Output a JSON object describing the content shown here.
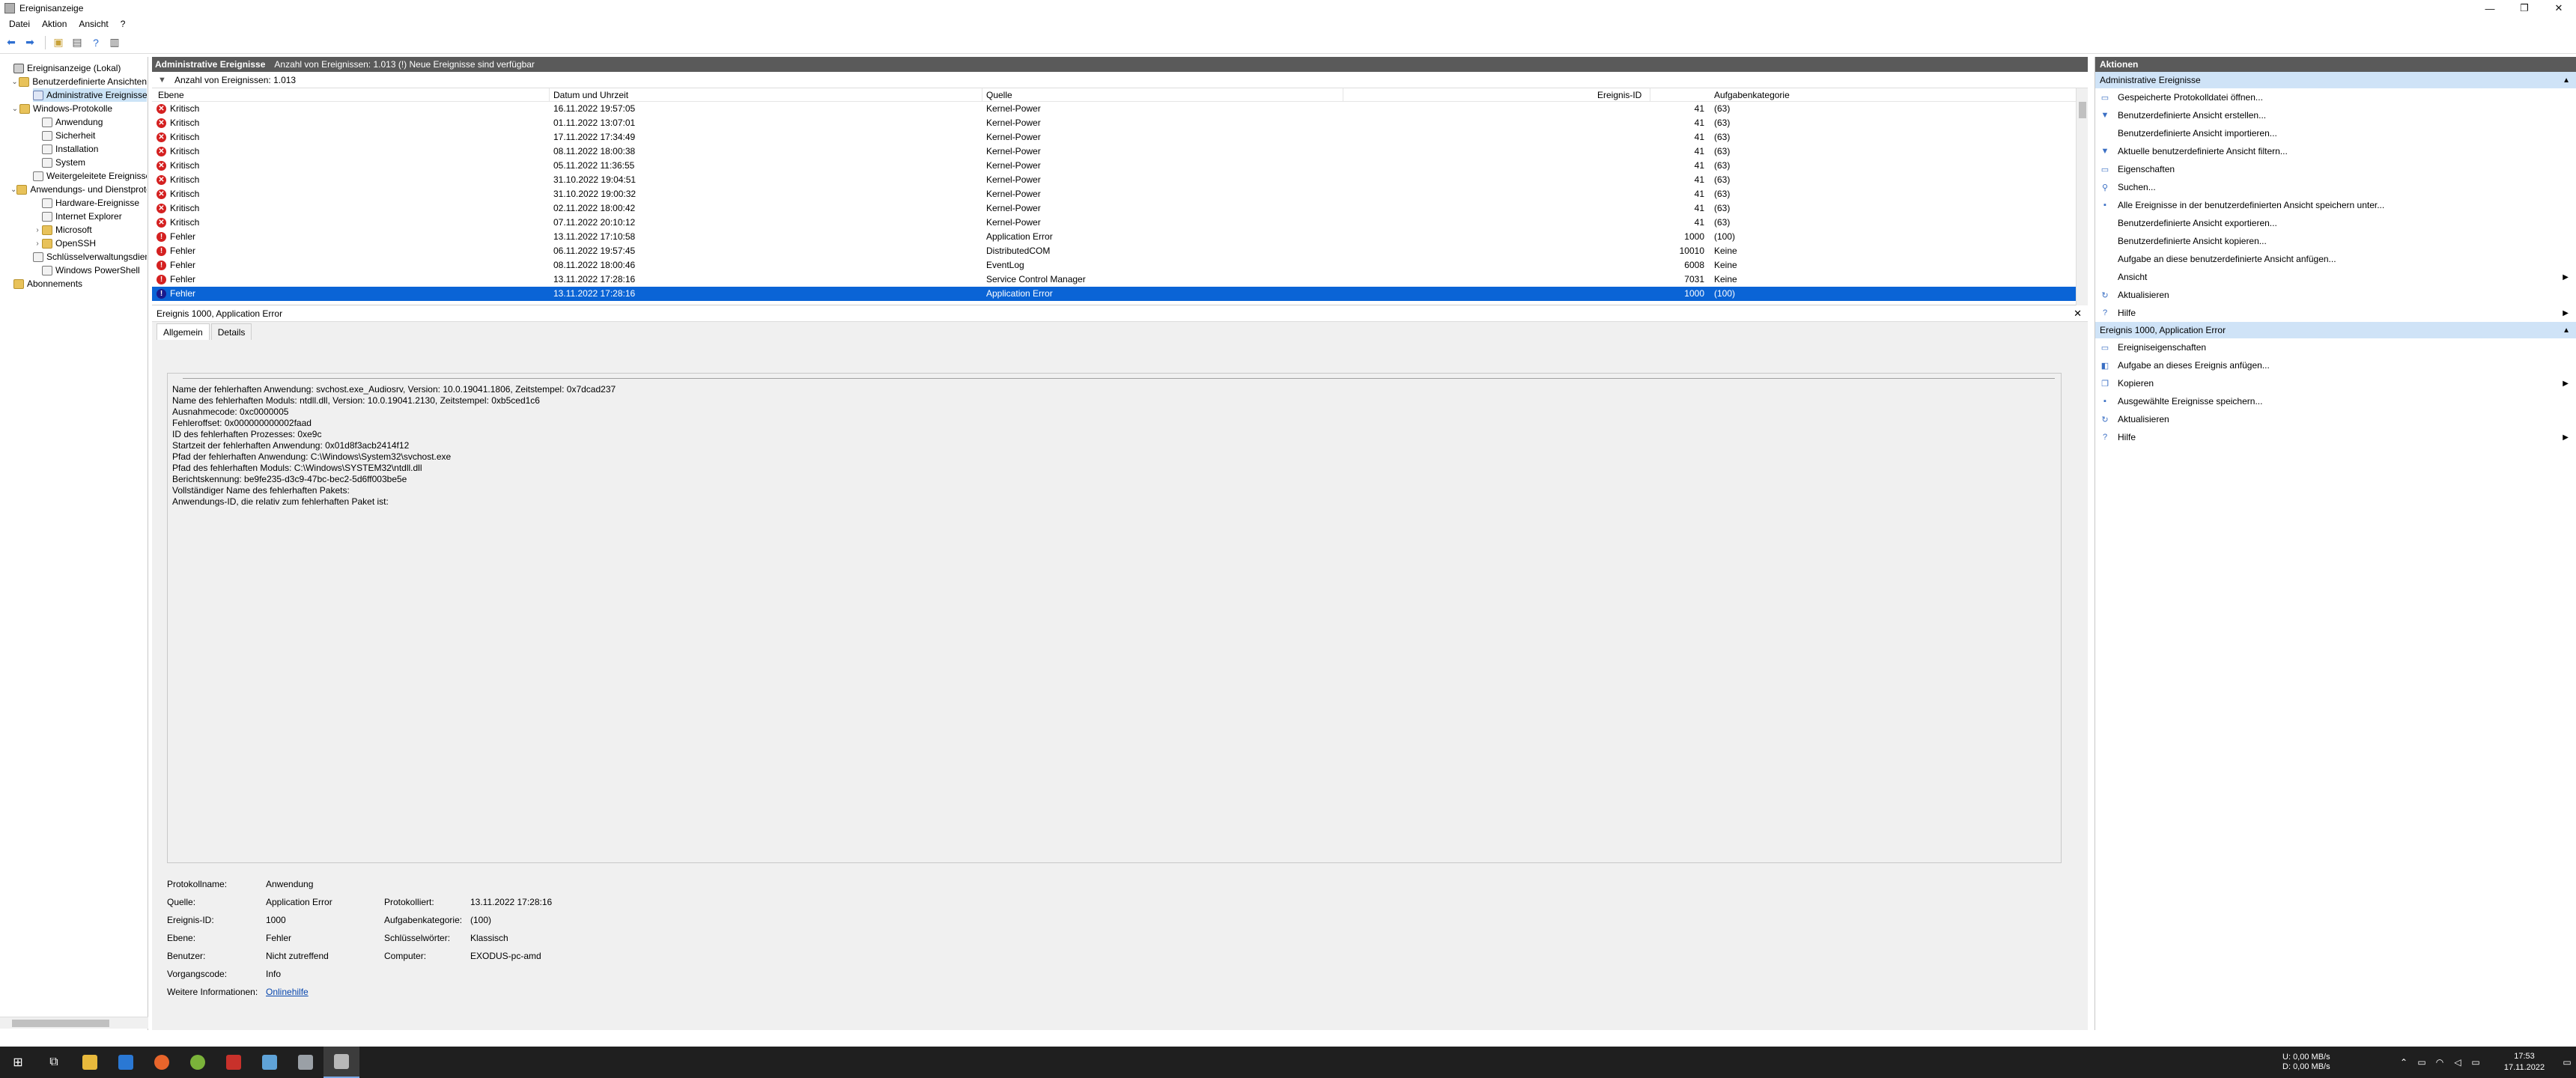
{
  "window": {
    "title": "Ereignisanzeige"
  },
  "menu": [
    "Datei",
    "Aktion",
    "Ansicht",
    "?"
  ],
  "tree": [
    {
      "label": "Ereignisanzeige (Lokal)",
      "level": 0,
      "icon": "root",
      "exp": ""
    },
    {
      "label": "Benutzerdefinierte Ansichten",
      "level": 1,
      "icon": "folder",
      "exp": "⌄"
    },
    {
      "label": "Administrative Ereignisse",
      "level": 2,
      "icon": "filter",
      "exp": "",
      "selected": true
    },
    {
      "label": "Windows-Protokolle",
      "level": 1,
      "icon": "folder",
      "exp": "⌄"
    },
    {
      "label": "Anwendung",
      "level": 2,
      "icon": "log",
      "exp": ""
    },
    {
      "label": "Sicherheit",
      "level": 2,
      "icon": "log",
      "exp": ""
    },
    {
      "label": "Installation",
      "level": 2,
      "icon": "log",
      "exp": ""
    },
    {
      "label": "System",
      "level": 2,
      "icon": "log",
      "exp": ""
    },
    {
      "label": "Weitergeleitete Ereignisse",
      "level": 2,
      "icon": "log",
      "exp": ""
    },
    {
      "label": "Anwendungs- und Dienstprotokolle",
      "level": 1,
      "icon": "folder",
      "exp": "⌄"
    },
    {
      "label": "Hardware-Ereignisse",
      "level": 2,
      "icon": "log",
      "exp": ""
    },
    {
      "label": "Internet Explorer",
      "level": 2,
      "icon": "log",
      "exp": ""
    },
    {
      "label": "Microsoft",
      "level": 2,
      "icon": "folder",
      "exp": "›"
    },
    {
      "label": "OpenSSH",
      "level": 2,
      "icon": "folder",
      "exp": "›"
    },
    {
      "label": "Schlüsselverwaltungsdienst",
      "level": 2,
      "icon": "log",
      "exp": ""
    },
    {
      "label": "Windows PowerShell",
      "level": 2,
      "icon": "log",
      "exp": ""
    },
    {
      "label": "Abonnements",
      "level": 0,
      "icon": "folder",
      "exp": ""
    }
  ],
  "middle": {
    "header_title": "Administrative Ereignisse",
    "header_info": "Anzahl von Ereignissen: 1.013 (!) Neue Ereignisse sind verfügbar",
    "filter_text": "Anzahl von Ereignissen: 1.013",
    "columns": {
      "level": "Ebene",
      "date": "Datum und Uhrzeit",
      "source": "Quelle",
      "id": "Ereignis-ID",
      "category": "Aufgabenkategorie"
    },
    "rows": [
      {
        "level": "Kritisch",
        "type": "crit",
        "date": "16.11.2022 19:57:05",
        "source": "Kernel-Power",
        "id": "41",
        "category": "(63)"
      },
      {
        "level": "Kritisch",
        "type": "crit",
        "date": "01.11.2022 13:07:01",
        "source": "Kernel-Power",
        "id": "41",
        "category": "(63)"
      },
      {
        "level": "Kritisch",
        "type": "crit",
        "date": "17.11.2022 17:34:49",
        "source": "Kernel-Power",
        "id": "41",
        "category": "(63)"
      },
      {
        "level": "Kritisch",
        "type": "crit",
        "date": "08.11.2022 18:00:38",
        "source": "Kernel-Power",
        "id": "41",
        "category": "(63)"
      },
      {
        "level": "Kritisch",
        "type": "crit",
        "date": "05.11.2022 11:36:55",
        "source": "Kernel-Power",
        "id": "41",
        "category": "(63)"
      },
      {
        "level": "Kritisch",
        "type": "crit",
        "date": "31.10.2022 19:04:51",
        "source": "Kernel-Power",
        "id": "41",
        "category": "(63)"
      },
      {
        "level": "Kritisch",
        "type": "crit",
        "date": "31.10.2022 19:00:32",
        "source": "Kernel-Power",
        "id": "41",
        "category": "(63)"
      },
      {
        "level": "Kritisch",
        "type": "crit",
        "date": "02.11.2022 18:00:42",
        "source": "Kernel-Power",
        "id": "41",
        "category": "(63)"
      },
      {
        "level": "Kritisch",
        "type": "crit",
        "date": "07.11.2022 20:10:12",
        "source": "Kernel-Power",
        "id": "41",
        "category": "(63)"
      },
      {
        "level": "Fehler",
        "type": "err",
        "date": "13.11.2022 17:10:58",
        "source": "Application Error",
        "id": "1000",
        "category": "(100)"
      },
      {
        "level": "Fehler",
        "type": "err",
        "date": "06.11.2022 19:57:45",
        "source": "DistributedCOM",
        "id": "10010",
        "category": "Keine"
      },
      {
        "level": "Fehler",
        "type": "err",
        "date": "08.11.2022 18:00:46",
        "source": "EventLog",
        "id": "6008",
        "category": "Keine"
      },
      {
        "level": "Fehler",
        "type": "err",
        "date": "13.11.2022 17:28:16",
        "source": "Service Control Manager",
        "id": "7031",
        "category": "Keine"
      },
      {
        "level": "Fehler",
        "type": "err",
        "date": "13.11.2022 17:28:16",
        "source": "Application Error",
        "id": "1000",
        "category": "(100)",
        "selected": true
      }
    ]
  },
  "detail": {
    "title": "Ereignis 1000, Application Error",
    "tabs": [
      "Allgemein",
      "Details"
    ],
    "description": [
      "Name der fehlerhaften Anwendung: svchost.exe_Audiosrv, Version: 10.0.19041.1806, Zeitstempel: 0x7dcad237",
      "Name des fehlerhaften Moduls: ntdll.dll, Version: 10.0.19041.2130, Zeitstempel: 0xb5ced1c6",
      "Ausnahmecode: 0xc0000005",
      "Fehleroffset: 0x000000000002faad",
      "ID des fehlerhaften Prozesses: 0xe9c",
      "Startzeit der fehlerhaften Anwendung: 0x01d8f3acb2414f12",
      "Pfad der fehlerhaften Anwendung: C:\\Windows\\System32\\svchost.exe",
      "Pfad des fehlerhaften Moduls: C:\\Windows\\SYSTEM32\\ntdll.dll",
      "Berichtskennung: be9fe235-d3c9-47bc-bec2-5d6ff003be5e",
      "Vollständiger Name des fehlerhaften Pakets:",
      "Anwendungs-ID, die relativ zum fehlerhaften Paket ist:"
    ],
    "props": {
      "log_label": "Protokollname:",
      "log_value": "Anwendung",
      "source_label": "Quelle:",
      "source_value": "Application Error",
      "logged_label": "Protokolliert:",
      "logged_value": "13.11.2022 17:28:16",
      "id_label": "Ereignis-ID:",
      "id_value": "1000",
      "task_label": "Aufgabenkategorie:",
      "task_value": "(100)",
      "level_label": "Ebene:",
      "level_value": "Fehler",
      "keywords_label": "Schlüsselwörter:",
      "keywords_value": "Klassisch",
      "user_label": "Benutzer:",
      "user_value": "Nicht zutreffend",
      "computer_label": "Computer:",
      "computer_value": "EXODUS-pc-amd",
      "opcode_label": "Vorgangscode:",
      "opcode_value": "Info",
      "more_label": "Weitere Informationen:",
      "more_link": "Onlinehilfe"
    }
  },
  "actions": {
    "title": "Aktionen",
    "section1": "Administrative Ereignisse",
    "items1": [
      {
        "label": "Gespeicherte Protokolldatei öffnen...",
        "icon": "open-log-icon",
        "glyph": "▭",
        "sub": false
      },
      {
        "label": "Benutzerdefinierte Ansicht erstellen...",
        "icon": "filter-icon",
        "glyph": "▼",
        "sub": false
      },
      {
        "label": "Benutzerdefinierte Ansicht importieren...",
        "icon": "",
        "glyph": "",
        "sub": false
      },
      {
        "label": "Aktuelle benutzerdefinierte Ansicht filtern...",
        "icon": "filter-icon",
        "glyph": "▼",
        "sub": false
      },
      {
        "label": "Eigenschaften",
        "icon": "properties-icon",
        "glyph": "▭",
        "sub": false
      },
      {
        "label": "Suchen...",
        "icon": "find-icon",
        "glyph": "⚲",
        "sub": false
      },
      {
        "label": "Alle Ereignisse in der benutzerdefinierten Ansicht speichern unter...",
        "icon": "save-icon",
        "glyph": "▪",
        "sub": false
      },
      {
        "label": "Benutzerdefinierte Ansicht exportieren...",
        "icon": "",
        "glyph": "",
        "sub": false
      },
      {
        "label": "Benutzerdefinierte Ansicht kopieren...",
        "icon": "",
        "glyph": "",
        "sub": false
      },
      {
        "label": "Aufgabe an diese benutzerdefinierte Ansicht anfügen...",
        "icon": "",
        "glyph": "",
        "sub": false
      },
      {
        "label": "Ansicht",
        "icon": "",
        "glyph": "",
        "sub": true
      },
      {
        "label": "Aktualisieren",
        "icon": "refresh-icon",
        "glyph": "↻",
        "sub": false
      },
      {
        "label": "Hilfe",
        "icon": "help-icon",
        "glyph": "?",
        "sub": true
      }
    ],
    "section2": "Ereignis 1000, Application Error",
    "items2": [
      {
        "label": "Ereigniseigenschaften",
        "icon": "properties-icon",
        "glyph": "▭",
        "sub": false
      },
      {
        "label": "Aufgabe an dieses Ereignis anfügen...",
        "icon": "task-icon",
        "glyph": "◧",
        "sub": false
      },
      {
        "label": "Kopieren",
        "icon": "copy-icon",
        "glyph": "❐",
        "sub": true
      },
      {
        "label": "Ausgewählte Ereignisse speichern...",
        "icon": "save-icon",
        "glyph": "▪",
        "sub": false
      },
      {
        "label": "Aktualisieren",
        "icon": "refresh-icon",
        "glyph": "↻",
        "sub": false
      },
      {
        "label": "Hilfe",
        "icon": "help-icon",
        "glyph": "?",
        "sub": true
      }
    ]
  },
  "tray": {
    "net_up": "U:",
    "net_up_val": "0,00 MB/s",
    "net_down": "D:",
    "net_down_val": "0,00 MB/s",
    "time": "17:53",
    "date": "17.11.2022"
  }
}
